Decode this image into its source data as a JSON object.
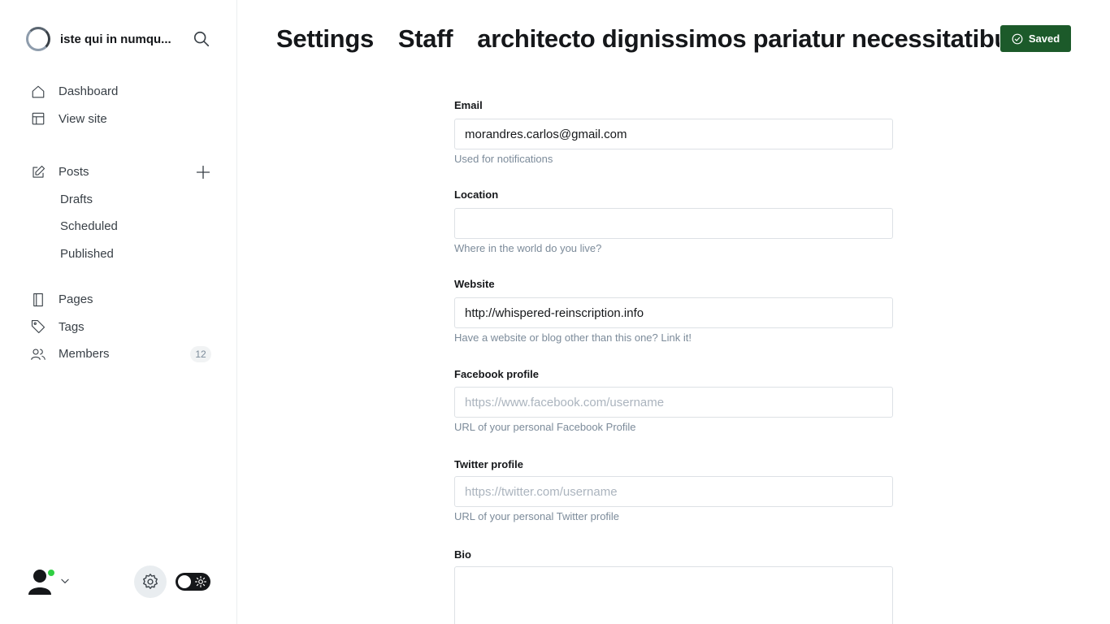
{
  "site": {
    "name": "iste qui in numqu..."
  },
  "nav": {
    "dashboard": "Dashboard",
    "view_site": "View site",
    "posts": "Posts",
    "drafts": "Drafts",
    "scheduled": "Scheduled",
    "published": "Published",
    "pages": "Pages",
    "tags": "Tags",
    "members": "Members",
    "members_count": "12"
  },
  "breadcrumb": {
    "settings": "Settings",
    "staff": "Staff",
    "current": "architecto dignissimos pariatur necessitatibus"
  },
  "save_button": {
    "label": "Saved"
  },
  "form": {
    "email": {
      "label": "Email",
      "value": "morandres.carlos@gmail.com",
      "hint": "Used for notifications"
    },
    "location": {
      "label": "Location",
      "value": "",
      "hint": "Where in the world do you live?"
    },
    "website": {
      "label": "Website",
      "value": "http://whispered-reinscription.info",
      "hint": "Have a website or blog other than this one? Link it!"
    },
    "facebook": {
      "label": "Facebook profile",
      "placeholder": "https://www.facebook.com/username",
      "hint": "URL of your personal Facebook Profile"
    },
    "twitter": {
      "label": "Twitter profile",
      "placeholder": "https://twitter.com/username",
      "hint": "URL of your personal Twitter profile"
    },
    "bio": {
      "label": "Bio",
      "value": ""
    }
  },
  "colors": {
    "accent": "#1c5a2a",
    "online": "#30cf43"
  },
  "icons": [
    "brand-logo",
    "search-icon",
    "home-icon",
    "layout-icon",
    "edit-icon",
    "plus-icon",
    "page-icon",
    "tag-icon",
    "members-icon",
    "user-icon",
    "chevron-down-icon",
    "gear-icon",
    "sun-icon",
    "check-circle-icon",
    "chevron-right-icon"
  ]
}
